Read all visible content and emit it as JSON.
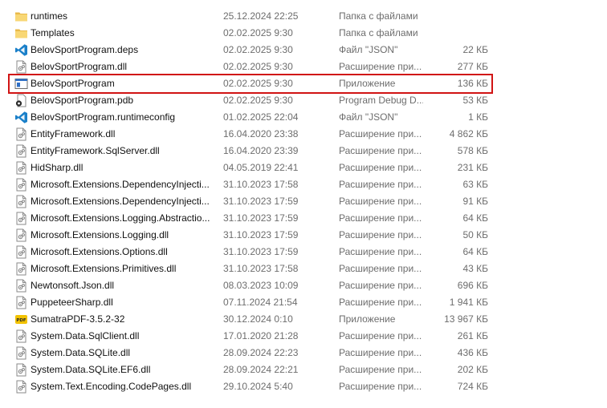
{
  "files": [
    {
      "name": "runtimes",
      "date": "25.12.2024 22:25",
      "type": "Папка с файлами",
      "size": "",
      "icon": "folder-icon"
    },
    {
      "name": "Templates",
      "date": "02.02.2025 9:30",
      "type": "Папка с файлами",
      "size": "",
      "icon": "folder-icon"
    },
    {
      "name": "BelovSportProgram.deps",
      "date": "02.02.2025 9:30",
      "type": "Файл \"JSON\"",
      "size": "22 КБ",
      "icon": "vscode-json-icon"
    },
    {
      "name": "BelovSportProgram.dll",
      "date": "02.02.2025 9:30",
      "type": "Расширение при...",
      "size": "277 КБ",
      "icon": "dll-file-icon"
    },
    {
      "name": "BelovSportProgram",
      "date": "02.02.2025 9:30",
      "type": "Приложение",
      "size": "136 КБ",
      "icon": "application-window-icon",
      "highlighted": true
    },
    {
      "name": "BelovSportProgram.pdb",
      "date": "02.02.2025 9:30",
      "type": "Program Debug D...",
      "size": "53 КБ",
      "icon": "pdb-file-icon"
    },
    {
      "name": "BelovSportProgram.runtimeconfig",
      "date": "01.02.2025 22:04",
      "type": "Файл \"JSON\"",
      "size": "1 КБ",
      "icon": "vscode-json-icon"
    },
    {
      "name": "EntityFramework.dll",
      "date": "16.04.2020 23:38",
      "type": "Расширение при...",
      "size": "4 862 КБ",
      "icon": "dll-file-icon"
    },
    {
      "name": "EntityFramework.SqlServer.dll",
      "date": "16.04.2020 23:39",
      "type": "Расширение при...",
      "size": "578 КБ",
      "icon": "dll-file-icon"
    },
    {
      "name": "HidSharp.dll",
      "date": "04.05.2019 22:41",
      "type": "Расширение при...",
      "size": "231 КБ",
      "icon": "dll-file-icon"
    },
    {
      "name": "Microsoft.Extensions.DependencyInjecti...",
      "date": "31.10.2023 17:58",
      "type": "Расширение при...",
      "size": "63 КБ",
      "icon": "dll-file-icon"
    },
    {
      "name": "Microsoft.Extensions.DependencyInjecti...",
      "date": "31.10.2023 17:59",
      "type": "Расширение при...",
      "size": "91 КБ",
      "icon": "dll-file-icon"
    },
    {
      "name": "Microsoft.Extensions.Logging.Abstractio...",
      "date": "31.10.2023 17:59",
      "type": "Расширение при...",
      "size": "64 КБ",
      "icon": "dll-file-icon"
    },
    {
      "name": "Microsoft.Extensions.Logging.dll",
      "date": "31.10.2023 17:59",
      "type": "Расширение при...",
      "size": "50 КБ",
      "icon": "dll-file-icon"
    },
    {
      "name": "Microsoft.Extensions.Options.dll",
      "date": "31.10.2023 17:59",
      "type": "Расширение при...",
      "size": "64 КБ",
      "icon": "dll-file-icon"
    },
    {
      "name": "Microsoft.Extensions.Primitives.dll",
      "date": "31.10.2023 17:58",
      "type": "Расширение при...",
      "size": "43 КБ",
      "icon": "dll-file-icon"
    },
    {
      "name": "Newtonsoft.Json.dll",
      "date": "08.03.2023 10:09",
      "type": "Расширение при...",
      "size": "696 КБ",
      "icon": "dll-file-icon"
    },
    {
      "name": "PuppeteerSharp.dll",
      "date": "07.11.2024 21:54",
      "type": "Расширение при...",
      "size": "1 941 КБ",
      "icon": "dll-file-icon"
    },
    {
      "name": "SumatraPDF-3.5.2-32",
      "date": "30.12.2024 0:10",
      "type": "Приложение",
      "size": "13 967 КБ",
      "icon": "sumatra-pdf-icon"
    },
    {
      "name": "System.Data.SqlClient.dll",
      "date": "17.01.2020 21:28",
      "type": "Расширение при...",
      "size": "261 КБ",
      "icon": "dll-file-icon"
    },
    {
      "name": "System.Data.SQLite.dll",
      "date": "28.09.2024 22:23",
      "type": "Расширение при...",
      "size": "436 КБ",
      "icon": "dll-file-icon"
    },
    {
      "name": "System.Data.SQLite.EF6.dll",
      "date": "28.09.2024 22:21",
      "type": "Расширение при...",
      "size": "202 КБ",
      "icon": "dll-file-icon"
    },
    {
      "name": "System.Text.Encoding.CodePages.dll",
      "date": "29.10.2024 5:40",
      "type": "Расширение при...",
      "size": "724 КБ",
      "icon": "dll-file-icon"
    }
  ],
  "colors": {
    "folder": "#f8d775",
    "vscode_blue": "#1b80c9",
    "highlight_border": "#d11414",
    "secondary_text": "#6d6d6d"
  }
}
